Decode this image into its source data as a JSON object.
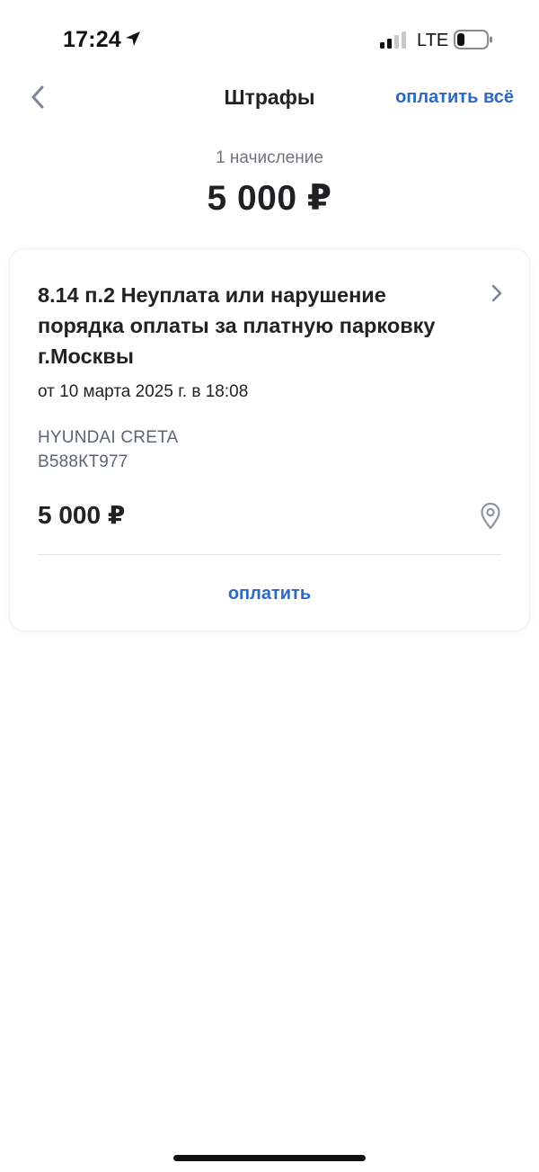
{
  "status_bar": {
    "time": "17:24",
    "network": "LTE",
    "icons": [
      "location-arrow-icon",
      "signal-icon",
      "battery-icon"
    ]
  },
  "nav": {
    "back_icon": "chevron-left-icon",
    "title": "Штрафы",
    "action_label": "оплатить всё"
  },
  "summary": {
    "count_label": "1 начисление",
    "total": "5 000 ₽"
  },
  "fines": [
    {
      "title": "8.14 п.2 Неуплата или нарушение порядка оплаты за платную парковку г.Москвы",
      "date": "от 10 марта 2025 г. в 18:08",
      "vehicle_model": "HYUNDAI CRETA",
      "vehicle_plate": "В588КТ977",
      "amount": "5 000 ₽",
      "pay_label": "оплатить",
      "icons": [
        "chevron-right-icon",
        "location-pin-icon"
      ]
    }
  ],
  "colors": {
    "accent": "#2a6ac2",
    "text_primary": "#222222",
    "text_secondary": "#5d6575",
    "muted": "#6e7380",
    "icon_gray": "#8e96a3"
  }
}
